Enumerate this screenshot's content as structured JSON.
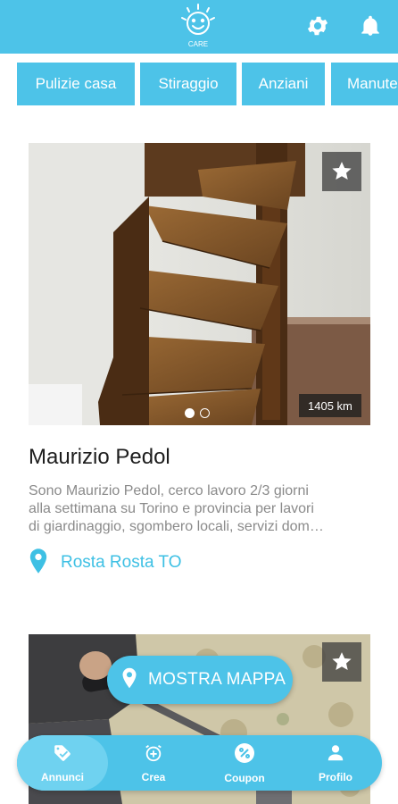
{
  "header": {
    "logo_text": "CARE",
    "icons": [
      "settings-icon",
      "bell-icon"
    ],
    "color": "#4dc3e8"
  },
  "categories": [
    "Pulizie casa",
    "Stiraggio",
    "Anziani",
    "Manutenzione"
  ],
  "listing": {
    "distance": "1405 km",
    "name": "Maurizio Pedol",
    "description_lines": [
      "Sono Maurizio Pedol,  cerco lavoro 2/3 giorni",
      "alla settimana su Torino e provincia per lavori",
      "di  giardinaggio, sgombero locali, servizi dom…"
    ],
    "location": "Rosta Rosta TO",
    "image_count": 2,
    "active_image": 1
  },
  "map_button": {
    "label": "MOSTRA MAPPA"
  },
  "bottom_nav": [
    {
      "label": "Annunci",
      "icon": "tag-check-icon",
      "active": true
    },
    {
      "label": "Crea",
      "icon": "alarm-plus-icon",
      "active": false
    },
    {
      "label": "Coupon",
      "icon": "percent-badge-icon",
      "active": false
    },
    {
      "label": "Profilo",
      "icon": "user-icon",
      "active": false
    }
  ],
  "colors": {
    "accent": "#4dc3e8",
    "location_text": "#3ec0e4"
  }
}
